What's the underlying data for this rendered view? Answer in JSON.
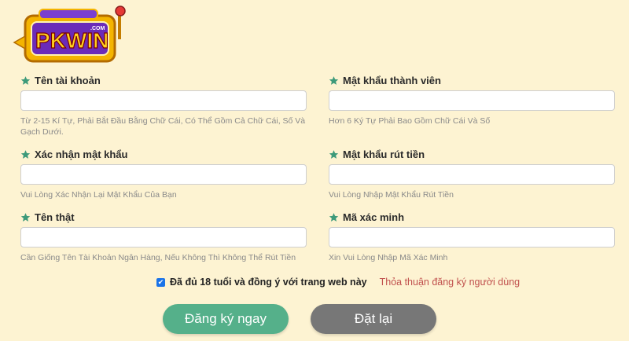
{
  "brand": {
    "logo_text": "PKWIN",
    "logo_sub": ".COM"
  },
  "fields": [
    {
      "label": "Tên tài khoản",
      "value": "",
      "hint": "Từ 2-15 Kí Tự, Phải Bắt Đầu Bằng Chữ Cái, Có Thể Gồm Cả Chữ Cái, Số Và Gạch Dưới."
    },
    {
      "label": "Mật khẩu thành viên",
      "value": "",
      "hint": "Hơn 6 Ký Tự Phải Bao Gồm Chữ Cái Và Số"
    },
    {
      "label": "Xác nhận mật khẩu",
      "value": "",
      "hint": "Vui Lòng Xác Nhận Lại Mật Khẩu Của Bạn"
    },
    {
      "label": "Mật khẩu rút tiền",
      "value": "",
      "hint": "Vui Lòng Nhập Mật Khẩu Rút Tiền"
    },
    {
      "label": "Tên thật",
      "value": "",
      "hint": "Cần Giống Tên Tài Khoản Ngân Hàng, Nếu Không Thì Không Thể Rút Tiền"
    },
    {
      "label": "Mã xác minh",
      "value": "",
      "hint": "Xin Vui Lòng Nhập Mã Xác Minh"
    }
  ],
  "agreement": {
    "checked": true,
    "text": "Đã đủ 18 tuổi và đồng ý với trang web này",
    "link": "Thỏa thuận đăng ký người dùng"
  },
  "buttons": {
    "register": "Đăng ký ngay",
    "reset": "Đặt lại"
  },
  "colors": {
    "background": "#fdf3d2",
    "star": "#3d9a7a",
    "register": "#55b08a",
    "reset": "#777777",
    "link": "#c0504d"
  },
  "icons": {
    "label": "star-icon",
    "checkbox": "checkmark-icon"
  }
}
